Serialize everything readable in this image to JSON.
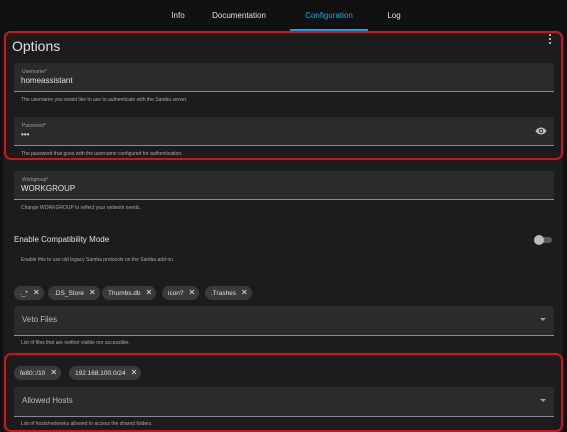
{
  "tabs": [
    {
      "label": "Info"
    },
    {
      "label": "Documentation"
    },
    {
      "label": "Configuration"
    },
    {
      "label": "Log"
    }
  ],
  "options": {
    "title": "Options",
    "username": {
      "label": "Username*",
      "value": "homeassistant",
      "helper": "The username you would like to use to authenticate with the Samba server."
    },
    "password": {
      "label": "Password*",
      "value": "•••",
      "helper": "The password that goes with the username configured for authentication."
    },
    "workgroup": {
      "label": "Workgroup*",
      "value": "WORKGROUP",
      "helper": "Change WORKGROUP to reflect your network needs."
    },
    "compatibility": {
      "label": "Enable Compatibility Mode",
      "helper": "Enable this to use old legacy Samba protocols on the Samba add-on.",
      "enabled": false
    },
    "veto_files": {
      "chips": [
        "._*",
        ".DS_Store",
        "Thumbs.db",
        "icon?",
        ".Trashes"
      ],
      "placeholder": "Veto Files",
      "helper": "List of files that are neither visible nor accessible."
    },
    "allowed_hosts": {
      "chips": [
        "fe80::/10",
        "192.168.100.0/24"
      ],
      "placeholder": "Allowed Hosts",
      "helper": "List of hosts/networks allowed to access the shared folders."
    }
  },
  "colors": {
    "accent": "#03a9f4",
    "highlight": "#d3131b",
    "background": "#111111",
    "card": "#1c1c1c"
  },
  "icons": {
    "menu": "more-vert-icon",
    "password_toggle": "eye-icon",
    "chip_remove": "close-icon",
    "dropdown": "chevron-down-icon"
  }
}
